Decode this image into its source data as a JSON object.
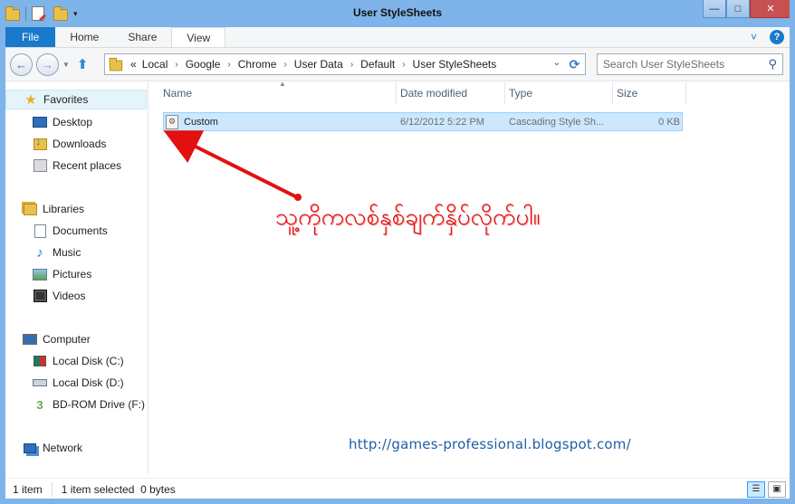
{
  "window": {
    "title": "User StyleSheets",
    "minimize_glyph": "—",
    "maximize_glyph": "□",
    "close_glyph": "✕",
    "accent_color": "#7eb4ea"
  },
  "ribbon": {
    "tabs": [
      {
        "label": "File"
      },
      {
        "label": "Home"
      },
      {
        "label": "Share"
      },
      {
        "label": "View"
      }
    ],
    "expand_glyph": "˅",
    "help_glyph": "?"
  },
  "address": {
    "back_glyph": "←",
    "forward_glyph": "→",
    "up_glyph": "⬆",
    "prefix": "«",
    "crumbs": [
      "Local",
      "Google",
      "Chrome",
      "User Data",
      "Default",
      "User StyleSheets"
    ],
    "crumb_sep": "›",
    "refresh_glyph": "⟳",
    "search_placeholder": "Search User StyleSheets",
    "search_icon": "⚲"
  },
  "nav": {
    "favorites": {
      "label": "Favorites",
      "icon": "star-icon"
    },
    "favorite_items": [
      {
        "label": "Desktop",
        "icon": "desktop-icon"
      },
      {
        "label": "Downloads",
        "icon": "downloads-icon"
      },
      {
        "label": "Recent places",
        "icon": "recent-places-icon"
      }
    ],
    "libraries": {
      "label": "Libraries",
      "icon": "libraries-icon"
    },
    "library_items": [
      {
        "label": "Documents",
        "icon": "documents-icon"
      },
      {
        "label": "Music",
        "icon": "music-icon"
      },
      {
        "label": "Pictures",
        "icon": "pictures-icon"
      },
      {
        "label": "Videos",
        "icon": "videos-icon"
      }
    ],
    "computer": {
      "label": "Computer",
      "icon": "computer-icon"
    },
    "computer_items": [
      {
        "label": "Local Disk (C:)",
        "icon": "local-disk-c-icon"
      },
      {
        "label": "Local Disk (D:)",
        "icon": "local-disk-d-icon"
      },
      {
        "label": "BD-ROM Drive (F:) Cal",
        "icon": "bd-rom-icon"
      }
    ],
    "network": {
      "label": "Network",
      "icon": "network-icon"
    }
  },
  "columns": [
    "Name",
    "Date modified",
    "Type",
    "Size"
  ],
  "files": [
    {
      "name": "Custom",
      "date_modified": "6/12/2012 5:22 PM",
      "type": "Cascading Style Sh...",
      "size": "0 KB",
      "icon": "css-file-icon"
    }
  ],
  "annotation": {
    "text": "သူ့ကိုကလစ်နှစ်ချက်နှိပ်လိုက်ပါ။",
    "color": "#e31010",
    "blog_url": "http://games-professional.blogspot.com/"
  },
  "status": {
    "item_count": "1 item",
    "selection": "1 item selected  0 bytes"
  }
}
